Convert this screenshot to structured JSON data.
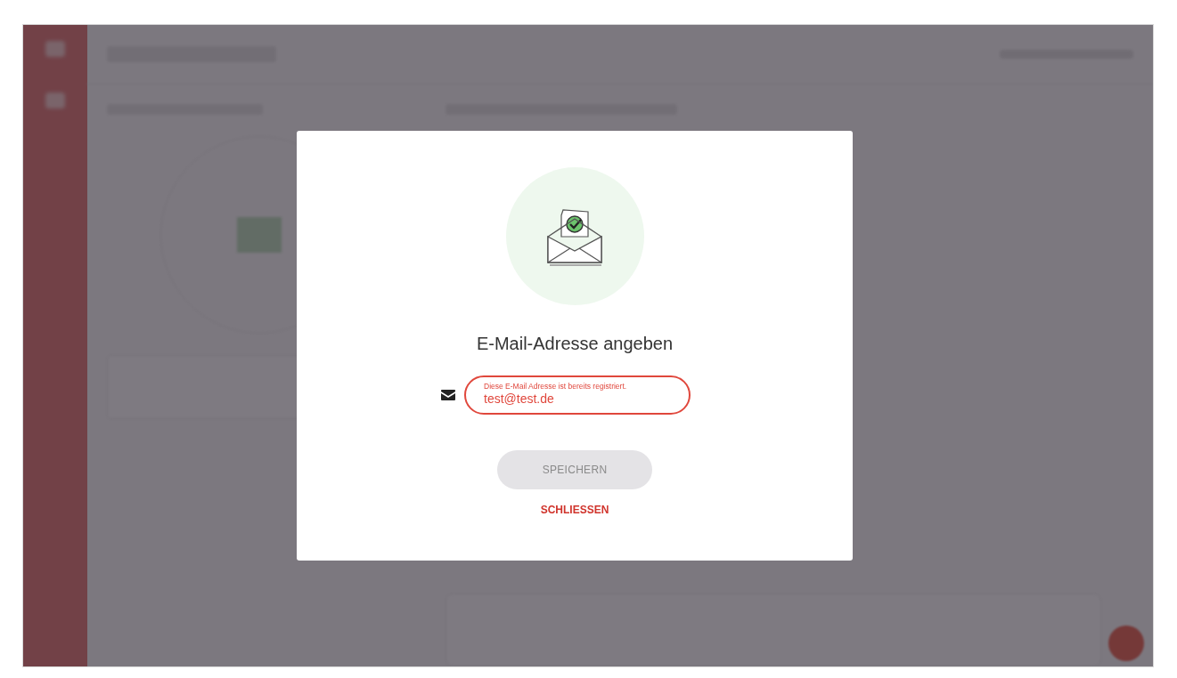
{
  "dialog": {
    "title": "E-Mail-Adresse angeben",
    "email_field": {
      "label": "Diese E-Mail Adresse ist bereits registriert.",
      "value": "test@test.de",
      "error": true
    },
    "save_button": {
      "label": "SPEICHERN",
      "disabled": true
    },
    "close_link": "SCHLIESSEN"
  }
}
